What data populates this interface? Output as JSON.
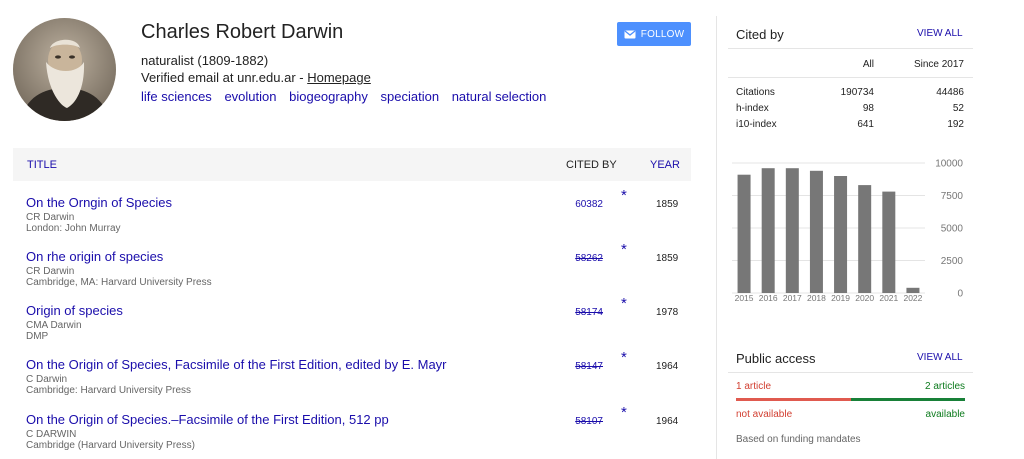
{
  "profile": {
    "name": "Charles Robert Darwin",
    "affiliation": "naturalist (1809-1882)",
    "email_text": "Verified email at unr.edu.ar - ",
    "homepage": "Homepage",
    "interests": [
      "life sciences",
      "evolution",
      "biogeography",
      "speciation",
      "natural selection"
    ],
    "follow_label": "FOLLOW"
  },
  "table": {
    "col_title": "TITLE",
    "col_cited": "CITED BY",
    "col_year": "YEAR",
    "rows": [
      {
        "title": "On the Orngin of Species",
        "authors": "CR Darwin",
        "pub": "London: John Murray",
        "cited": "60382",
        "cited_struck": false,
        "star": "*",
        "year": "1859"
      },
      {
        "title": "On rhe origin of species",
        "authors": "CR Darwin",
        "pub": "Cambridge, MA: Harvard University Press",
        "cited": "58262",
        "cited_struck": true,
        "star": "*",
        "year": "1859"
      },
      {
        "title": "Origin of species",
        "authors": "CMA Darwin",
        "pub": "DMP",
        "cited": "58174",
        "cited_struck": true,
        "star": "*",
        "year": "1978"
      },
      {
        "title": "On the Origin of Species, Facsimile of the First Edition, edited by E. Mayr",
        "authors": "C Darwin",
        "pub": "Cambridge: Harvard University Press",
        "cited": "58147",
        "cited_struck": true,
        "star": "*",
        "year": "1964"
      },
      {
        "title": "On the Origin of Species.–Facsimile of the First Edition, 512 pp",
        "authors": "C DARWIN",
        "pub": "Cambridge (Harvard University Press)",
        "cited": "58107",
        "cited_struck": true,
        "star": "*",
        "year": "1964"
      }
    ]
  },
  "cited_by": {
    "title": "Cited by",
    "view_all": "VIEW ALL",
    "col_all": "All",
    "col_since": "Since 2017",
    "stats": [
      {
        "label": "Citations",
        "all": "190734",
        "since": "44486"
      },
      {
        "label": "h-index",
        "all": "98",
        "since": "52"
      },
      {
        "label": "i10-index",
        "all": "641",
        "since": "192"
      }
    ]
  },
  "chart_data": {
    "type": "bar",
    "categories": [
      "2015",
      "2016",
      "2017",
      "2018",
      "2019",
      "2020",
      "2021",
      "2022"
    ],
    "values": [
      9100,
      9600,
      9600,
      9400,
      9000,
      8300,
      7800,
      400
    ],
    "y_ticks": [
      "10000",
      "7500",
      "5000",
      "2500",
      "0"
    ],
    "ylim": [
      0,
      10000
    ],
    "bar_color": "#777777",
    "grid": true
  },
  "public_access": {
    "title": "Public access",
    "view_all": "VIEW ALL",
    "left_count": "1 article",
    "right_count": "2 articles",
    "left_status": "not available",
    "right_status": "available",
    "available_fraction": 0.5,
    "note": "Based on funding mandates"
  },
  "colors": {
    "link": "#1a0dab",
    "follow": "#4d90fe",
    "unavailable": "#d23f31",
    "available": "#188038"
  }
}
